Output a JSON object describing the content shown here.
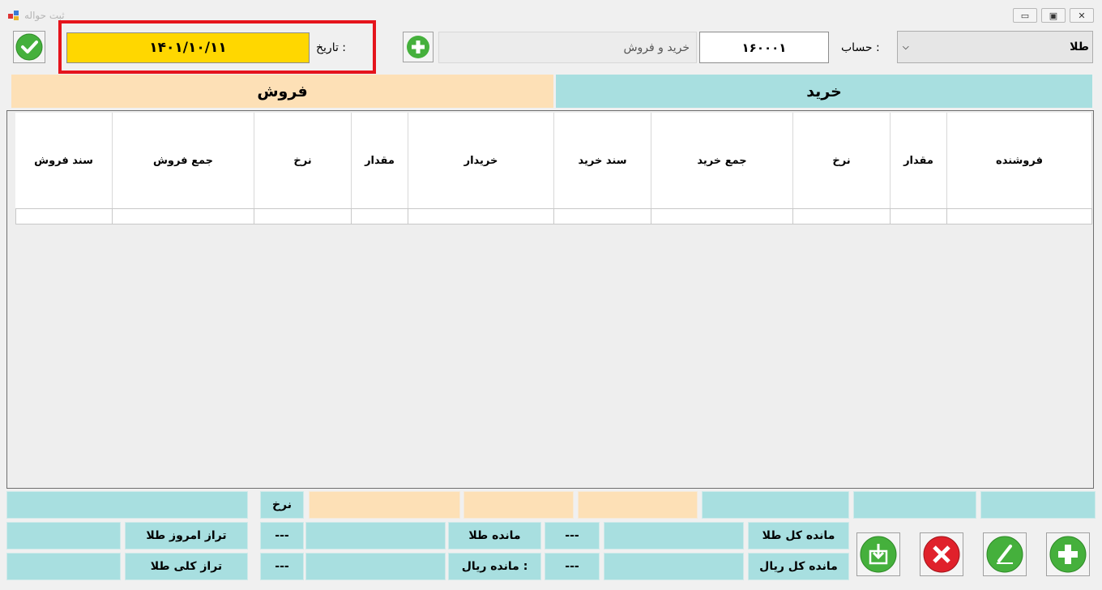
{
  "window": {
    "title": "ثبت حواله"
  },
  "header": {
    "date_label": "تاریخ :",
    "date_value": "۱۴۰۱/۱۰/۱۱",
    "doc_type_value": "خرید و فروش",
    "account_number": "۱۶۰۰۰۱",
    "account_label": "حساب :",
    "product_value": "طلا"
  },
  "panels": {
    "buy": "خرید",
    "sell": "فروش"
  },
  "grid": {
    "columns": [
      "فروشنده",
      "مقدار",
      "نرخ",
      "جمع خرید",
      "سند خرید",
      "خریدار",
      "مقدار",
      "نرخ",
      "جمع فروش",
      "سند فروش"
    ]
  },
  "footer": {
    "rate_label": "نرخ",
    "total_gold_label": "مانده کل طلا",
    "total_rial_label": "مانده کل ریال",
    "gold_label": "مانده طلا",
    "rial_label": "مانده ریال :",
    "today_balance_label": "تراز امروز طلا",
    "total_balance_label": "تراز کلی طلا",
    "dash1": "---",
    "dash2": "---",
    "dash3": "---",
    "dash4": "---"
  },
  "colors": {
    "highlight": "#ff0000",
    "date_bg": "#ffd700",
    "buy_bg": "#a8dfe0",
    "sell_bg": "#fde0b6"
  },
  "icons": [
    "confirm-check-icon",
    "add-icon",
    "download-icon",
    "delete-icon",
    "edit-icon",
    "add-icon"
  ]
}
